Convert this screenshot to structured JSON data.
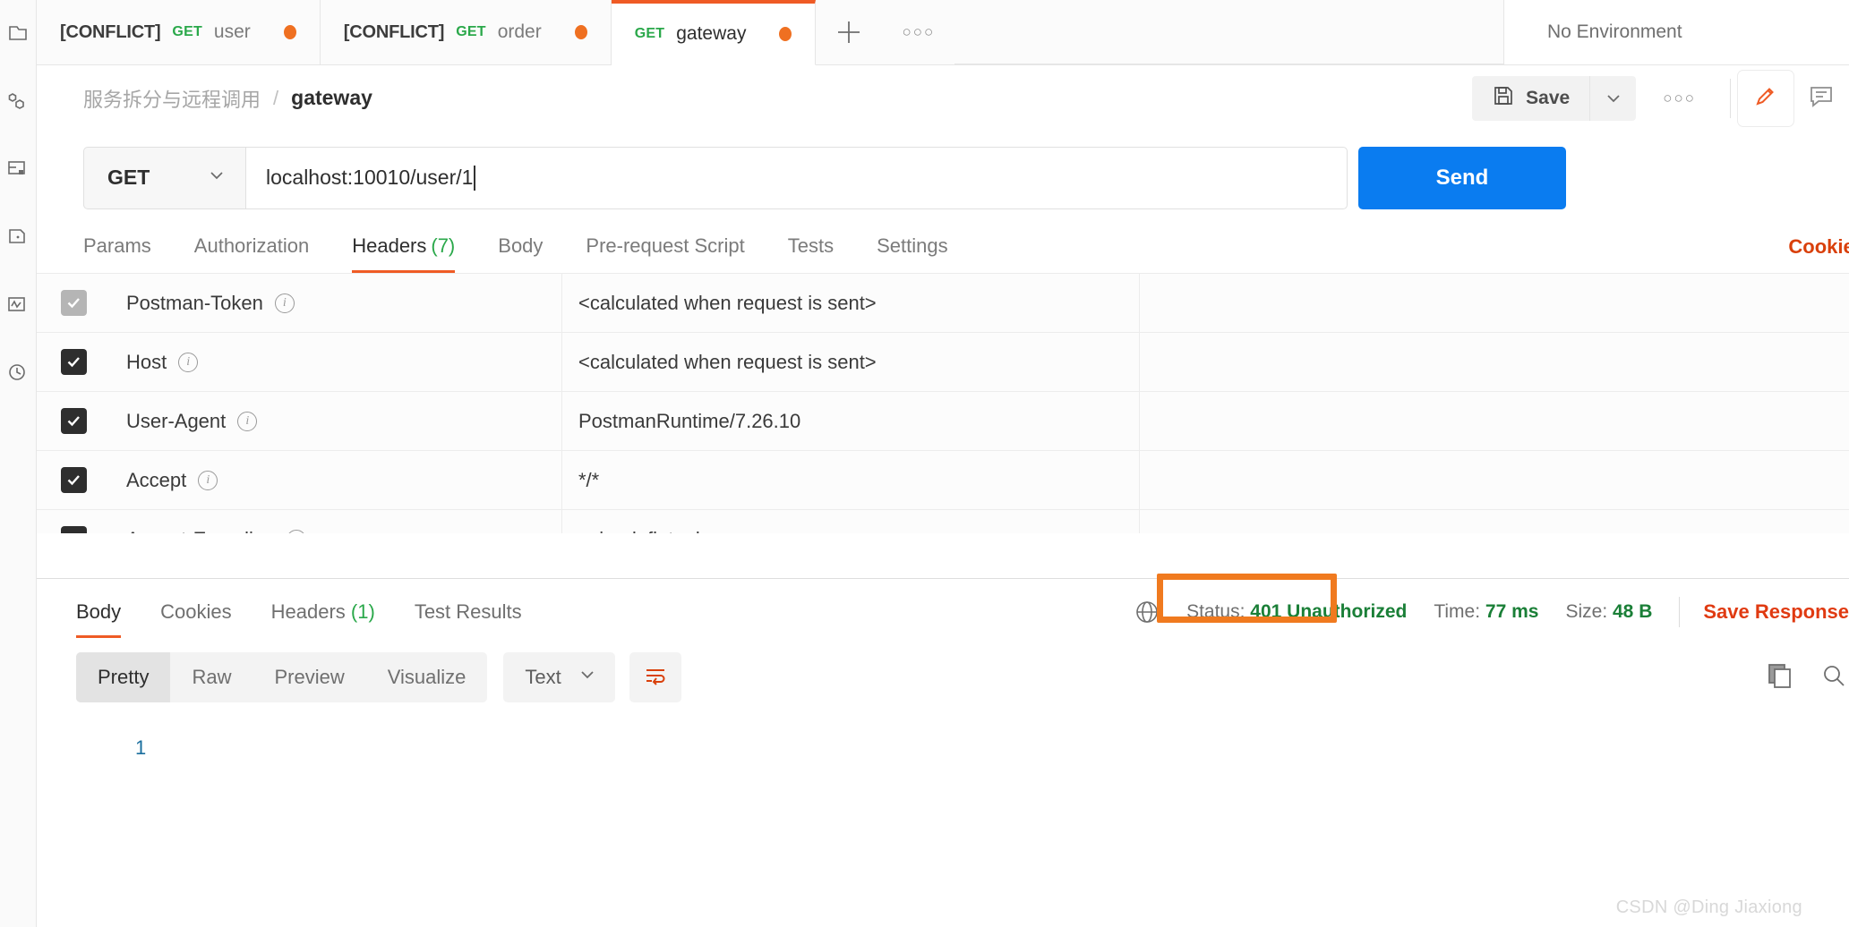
{
  "sidebar": {
    "items": [
      {
        "name": "collections",
        "icon": "collections-icon"
      },
      {
        "name": "apis",
        "icon": "apis-icon"
      },
      {
        "name": "environments",
        "icon": "environments-icon"
      },
      {
        "name": "mock-servers",
        "icon": "mock-servers-icon"
      },
      {
        "name": "monitors",
        "icon": "monitors-icon"
      },
      {
        "name": "history",
        "icon": "history-icon"
      }
    ]
  },
  "tabstrip": {
    "tabs": [
      {
        "prefix": "[CONFLICT]",
        "method": "GET",
        "name": "user",
        "unsaved": true,
        "active": false
      },
      {
        "prefix": "[CONFLICT]",
        "method": "GET",
        "name": "order",
        "unsaved": true,
        "active": false
      },
      {
        "prefix": "",
        "method": "GET",
        "name": "gateway",
        "unsaved": true,
        "active": true
      }
    ],
    "new_tab_label": "+",
    "more_label": "○○○",
    "environment": "No Environment"
  },
  "breadcrumb": {
    "collection": "服务拆分与远程调用",
    "separator": "/",
    "current": "gateway",
    "save_label": "Save",
    "more_label": "○○○"
  },
  "request": {
    "method": "GET",
    "url": "localhost:10010/user/1",
    "send_label": "Send",
    "tabs": [
      {
        "label": "Params",
        "count": "",
        "active": false
      },
      {
        "label": "Authorization",
        "count": "",
        "active": false
      },
      {
        "label": "Headers",
        "count": "(7)",
        "active": true
      },
      {
        "label": "Body",
        "count": "",
        "active": false
      },
      {
        "label": "Pre-request Script",
        "count": "",
        "active": false
      },
      {
        "label": "Tests",
        "count": "",
        "active": false
      },
      {
        "label": "Settings",
        "count": "",
        "active": false
      }
    ],
    "cookies_link": "Cookies"
  },
  "headers_table": {
    "rows": [
      {
        "checked": true,
        "muted": true,
        "key": "Postman-Token",
        "value": "<calculated when request is sent>",
        "description": ""
      },
      {
        "checked": true,
        "muted": false,
        "key": "Host",
        "value": "<calculated when request is sent>",
        "description": ""
      },
      {
        "checked": true,
        "muted": false,
        "key": "User-Agent",
        "value": "PostmanRuntime/7.26.10",
        "description": ""
      },
      {
        "checked": true,
        "muted": false,
        "key": "Accept",
        "value": "*/*",
        "description": ""
      },
      {
        "checked": true,
        "muted": false,
        "key": "Accept-Encoding",
        "value": "gzip, deflate, br",
        "description": ""
      }
    ]
  },
  "response": {
    "tabs": [
      {
        "label": "Body",
        "count": "",
        "active": true
      },
      {
        "label": "Cookies",
        "count": "",
        "active": false
      },
      {
        "label": "Headers",
        "count": "(1)",
        "active": false
      },
      {
        "label": "Test Results",
        "count": "",
        "active": false
      }
    ],
    "status_label": "Status:",
    "status_value": "401 Unauthorized",
    "time_label": "Time:",
    "time_value": "77 ms",
    "size_label": "Size:",
    "size_value": "48 B",
    "save_response": "Save Response",
    "format_tabs": [
      {
        "label": "Pretty",
        "active": true
      },
      {
        "label": "Raw",
        "active": false
      },
      {
        "label": "Preview",
        "active": false
      },
      {
        "label": "Visualize",
        "active": false
      }
    ],
    "content_type": "Text",
    "body_lines": [
      "1"
    ],
    "body_text": ""
  },
  "watermark": "CSDN @Ding Jiaxiong",
  "colors": {
    "accent_orange": "#ef5b25",
    "highlight_orange": "#f07a1f",
    "method_green": "#2aa84a",
    "status_green": "#1a7f37",
    "send_blue": "#0a7cf0",
    "link_red": "#e03a11"
  }
}
